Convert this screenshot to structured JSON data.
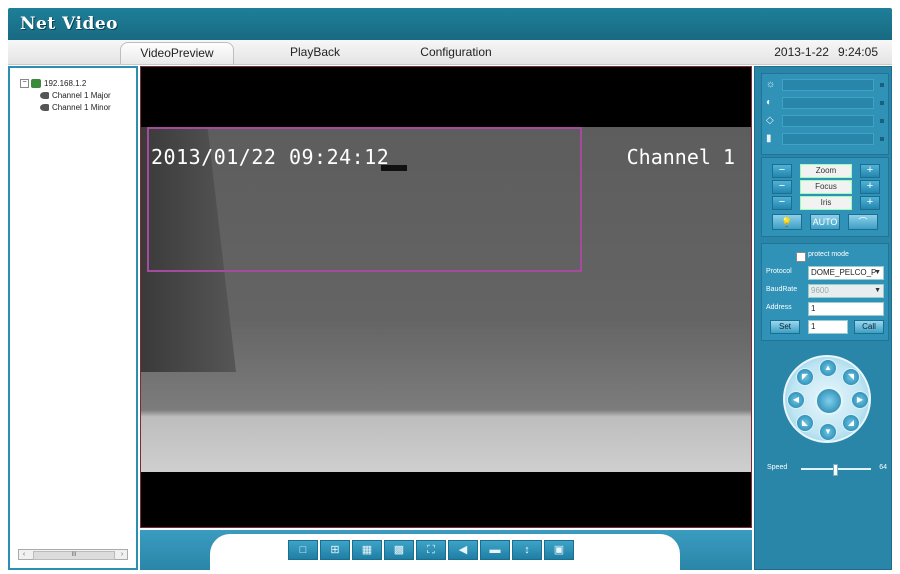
{
  "app": {
    "title": "Net Video"
  },
  "tabs": [
    {
      "label": "VideoPreview",
      "active": true
    },
    {
      "label": "PlayBack",
      "active": false
    },
    {
      "label": "Configuration",
      "active": false
    }
  ],
  "datetime": {
    "date": "2013-1-22",
    "time": "9:24:05"
  },
  "tree": {
    "device": "192.168.1.2",
    "channels": [
      "Channel 1 Major",
      "Channel 1 Minor"
    ],
    "scroll_label": "III"
  },
  "video": {
    "osd_datetime": "2013/01/22 09:24:12",
    "osd_channel": "Channel 1"
  },
  "toolbar": {
    "buttons": [
      {
        "icon": "single-view-icon",
        "glyph": "□"
      },
      {
        "icon": "quad-view-icon",
        "glyph": "⊞"
      },
      {
        "icon": "nine-view-icon",
        "glyph": "▦"
      },
      {
        "icon": "sixteen-view-icon",
        "glyph": "▩"
      },
      {
        "icon": "fullscreen-icon",
        "glyph": "⛶"
      },
      {
        "icon": "audio-icon",
        "glyph": "◀"
      },
      {
        "icon": "record-icon",
        "glyph": "▬"
      },
      {
        "icon": "talk-icon",
        "glyph": "↕"
      },
      {
        "icon": "snapshot-icon",
        "glyph": "▣"
      }
    ]
  },
  "image_adjust": {
    "rows": [
      {
        "icon": "brightness-icon",
        "glyph": "☼"
      },
      {
        "icon": "contrast-icon",
        "glyph": "◐"
      },
      {
        "icon": "saturation-icon",
        "glyph": "◇"
      },
      {
        "icon": "hue-icon",
        "glyph": "▮"
      }
    ]
  },
  "lens": {
    "zoom": "Zoom",
    "focus": "Focus",
    "iris": "Iris",
    "minus": "−",
    "plus": "+",
    "light_label": "💡",
    "auto_label": "AUTO",
    "wiper_label": "⌒"
  },
  "protocol": {
    "protect_mode": "protect mode",
    "protocol_label": "Protocol",
    "protocol_value": "DOME_PELCO_P",
    "baud_label": "BaudRate",
    "baud_value": "9600",
    "address_label": "Address",
    "address_value": "1",
    "set_label": "Set",
    "preset_value": "1",
    "call_label": "Call"
  },
  "ptz": {
    "speed_label": "Speed",
    "speed_max": "64",
    "speed_level": 0.45
  },
  "colors": {
    "title_bar": "#1f7f99",
    "panel_blue": "#2a86a8",
    "motion_box": "#a64a9e"
  }
}
